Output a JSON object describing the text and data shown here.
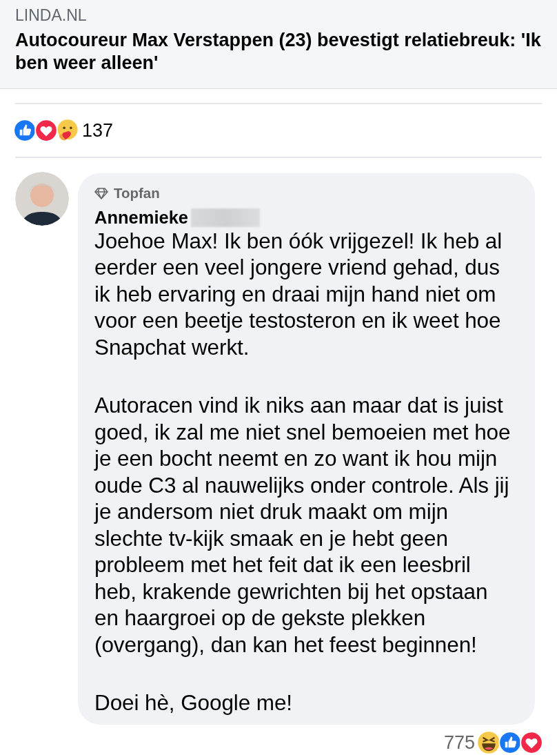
{
  "link_preview": {
    "source": "LINDA.NL",
    "title": "Autocoureur Max Verstappen (23) bevestigt relatiebreuk: 'Ik ben weer alleen'"
  },
  "post_reactions": {
    "count": "137"
  },
  "comment": {
    "badge": "Topfan",
    "author": "Annemieke",
    "name_redacted": true,
    "paragraphs": [
      [
        "Joehoe Max! Ik ben óók vrijgezel! Ik heb al",
        "eerder een veel jongere vriend gehad, dus",
        "ik heb ervaring en draai mijn hand niet om",
        "voor een beetje testosteron en ik weet hoe",
        "Snapchat werkt."
      ],
      [
        "Autoracen vind ik niks aan maar dat is juist",
        "goed, ik zal me niet snel bemoeien met hoe",
        "je een bocht neemt en zo want ik hou mijn",
        "oude C3 al nauwelijks onder controle. Als jij",
        "je andersom niet druk maakt om mijn",
        "slechte tv-kijk smaak en je hebt geen",
        "probleem met het feit dat ik een leesbril",
        "heb, krakende gewrichten bij het opstaan",
        "en haargroei op de gekste plekken",
        "(overgang), dan kan het feest beginnen!"
      ],
      [
        "Doei hè, Google me!"
      ]
    ],
    "reactions": {
      "count": "775"
    }
  }
}
